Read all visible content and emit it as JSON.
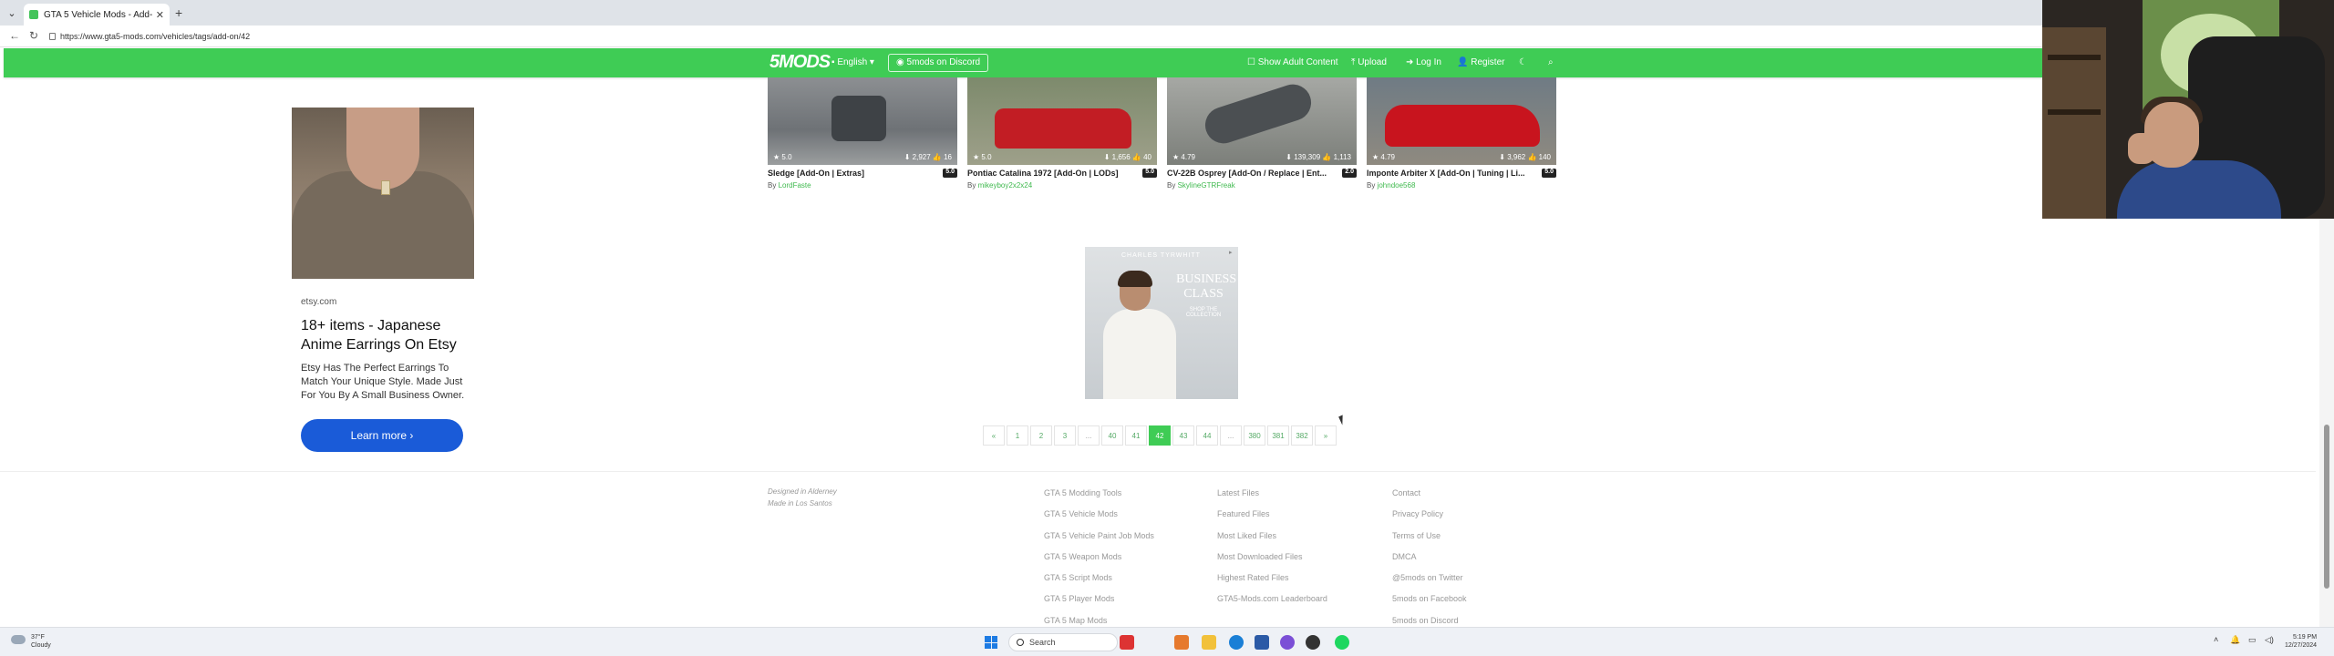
{
  "browser": {
    "tab_title": "GTA 5 Vehicle Mods - Add-On - G",
    "close": "✕",
    "new_tab": "+",
    "url": "https://www.gta5-mods.com/vehicles/tags/add-on/42"
  },
  "nav": {
    "logo": "5MODS",
    "language": "English",
    "discord": "5mods on Discord",
    "adult": "Show Adult Content",
    "upload": "Upload",
    "login": "Log In",
    "register": "Register"
  },
  "cards": [
    {
      "title": "Sledge [Add-On | Extras]",
      "rating": "5.0",
      "stat_rating": "5.0",
      "downloads": "2,927",
      "likes": "16",
      "author_prefix": "By",
      "author": "LordFaste"
    },
    {
      "title": "Pontiac Catalina 1972 [Add-On | LODs]",
      "rating": "5.0",
      "stat_rating": "5.0",
      "downloads": "1,656",
      "likes": "40",
      "author_prefix": "By",
      "author": "mikeyboy2x2x24"
    },
    {
      "title": "CV-22B Osprey [Add-On / Replace | Ent...",
      "rating": "2.0",
      "stat_rating": "4.79",
      "downloads": "139,309",
      "likes": "1,113",
      "author_prefix": "By",
      "author": "SkylineGTRFreak"
    },
    {
      "title": "Imponte Arbiter X [Add-On | Tuning | Li...",
      "rating": "5.0",
      "stat_rating": "4.79",
      "downloads": "3,962",
      "likes": "140",
      "author_prefix": "By",
      "author": "johndoe568"
    }
  ],
  "ad_left": {
    "domain": "etsy.com",
    "title": "18+ items - Japanese Anime Earrings On Etsy",
    "description": "Etsy Has The Perfect Earrings To Match Your Unique Style. Made Just For You By A Small Business Owner.",
    "button": "Learn more  ›"
  },
  "ad_center": {
    "brand": "CHARLES TYRWHITT",
    "title": "BUSINESS CLASS",
    "subtitle": "SHOP THE COLLECTION"
  },
  "pagination": [
    "«",
    "1",
    "2",
    "3",
    "...",
    "40",
    "41",
    "42",
    "43",
    "44",
    "...",
    "380",
    "381",
    "382",
    "»"
  ],
  "pagination_active": "42",
  "footer": {
    "credit_1": "Designed in Alderney",
    "credit_2": "Made in Los Santos",
    "col1": [
      "GTA 5 Modding Tools",
      "GTA 5 Vehicle Mods",
      "GTA 5 Vehicle Paint Job Mods",
      "GTA 5 Weapon Mods",
      "GTA 5 Script Mods",
      "GTA 5 Player Mods",
      "GTA 5 Map Mods"
    ],
    "col2": [
      "Latest Files",
      "Featured Files",
      "Most Liked Files",
      "Most Downloaded Files",
      "Highest Rated Files",
      "GTA5-Mods.com Leaderboard"
    ],
    "col3": [
      "Contact",
      "Privacy Policy",
      "Terms of Use",
      "DMCA",
      "@5mods on Twitter",
      "5mods on Facebook",
      "5mods on Discord"
    ]
  },
  "taskbar": {
    "temp": "37°F",
    "weather": "Cloudy",
    "search": "Search",
    "time": "5:19 PM",
    "date": "12/27/2024"
  },
  "colors": {
    "brand": "#3fcc55",
    "ad_button": "#1a5bd8"
  }
}
